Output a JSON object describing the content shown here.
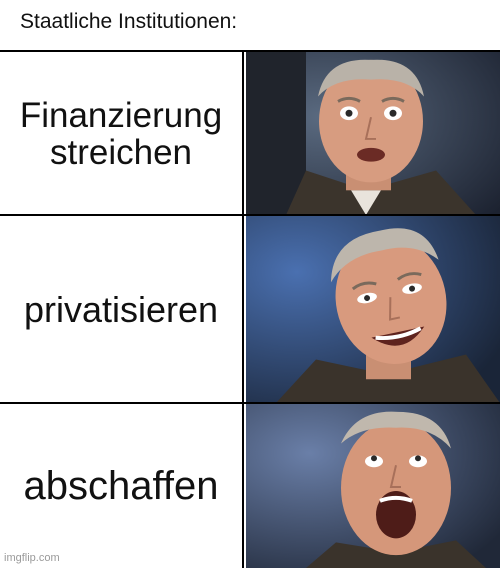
{
  "header": {
    "title": "Staatliche Institutionen:"
  },
  "rows": [
    {
      "label": "Finanzierung streichen",
      "image": "excited-man-reaction-1"
    },
    {
      "label": "privatisieren",
      "image": "excited-man-reaction-2"
    },
    {
      "label": "abschaffen",
      "image": "excited-man-reaction-3"
    }
  ],
  "watermark": "imgflip.com",
  "colors": {
    "border": "#000000",
    "text": "#111111",
    "background": "#ffffff"
  }
}
